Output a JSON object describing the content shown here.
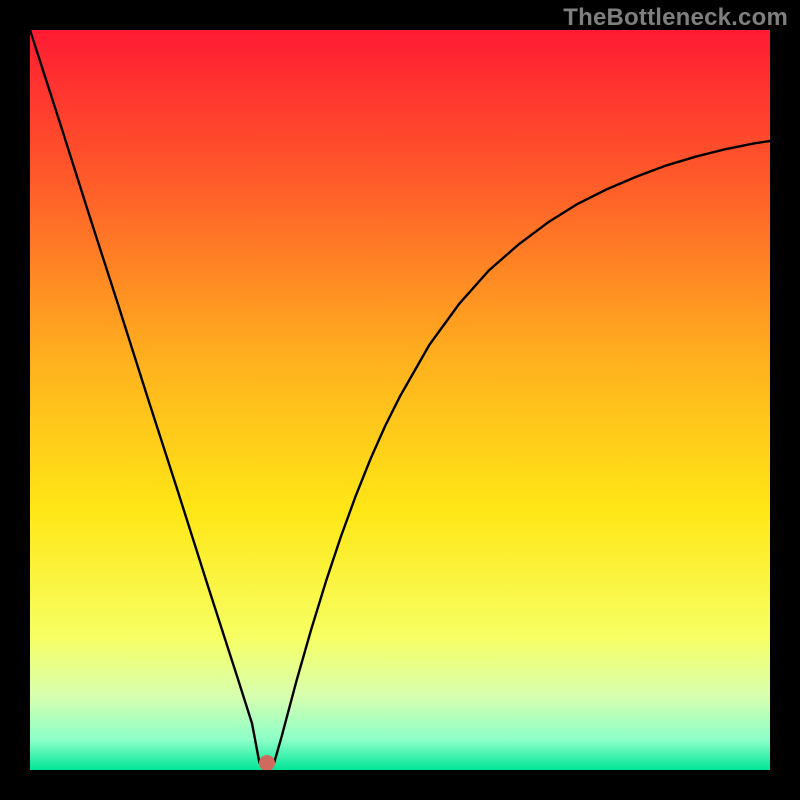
{
  "watermark": "TheBottleneck.com",
  "colors": {
    "frame": "#000000",
    "watermark": "#7f7f7f",
    "curve": "#000000",
    "minpoint": "#cf6a5c",
    "gradient_stops": [
      {
        "pos": 0.0,
        "color": "#ff1b33"
      },
      {
        "pos": 0.2,
        "color": "#ff5a2a"
      },
      {
        "pos": 0.45,
        "color": "#ffb21e"
      },
      {
        "pos": 0.65,
        "color": "#ffe716"
      },
      {
        "pos": 0.82,
        "color": "#f7ff63"
      },
      {
        "pos": 0.9,
        "color": "#d8ffb0"
      },
      {
        "pos": 0.96,
        "color": "#8affc8"
      },
      {
        "pos": 1.0,
        "color": "#00e597"
      }
    ]
  },
  "chart_data": {
    "type": "line",
    "title": "",
    "xlabel": "",
    "ylabel": "",
    "xlim": [
      0,
      100
    ],
    "ylim": [
      0,
      100
    ],
    "x": [
      0,
      2,
      4,
      6,
      8,
      10,
      12,
      14,
      16,
      18,
      20,
      22,
      24,
      26,
      28,
      30,
      31,
      32,
      33,
      34,
      36,
      38,
      40,
      42,
      44,
      46,
      48,
      50,
      54,
      58,
      62,
      66,
      70,
      74,
      78,
      82,
      86,
      90,
      94,
      98,
      100
    ],
    "values": [
      100,
      93.8,
      87.6,
      81.3,
      75,
      68.8,
      62.6,
      56.3,
      50,
      43.8,
      37.6,
      31.3,
      25,
      18.8,
      12.6,
      6.3,
      1.0,
      1.0,
      1.0,
      4.5,
      12.0,
      19.0,
      25.5,
      31.5,
      37.0,
      42.0,
      46.5,
      50.5,
      57.5,
      63.0,
      67.5,
      71.0,
      74.0,
      76.5,
      78.5,
      80.2,
      81.7,
      82.9,
      83.9,
      84.7,
      85.0
    ],
    "min_point": {
      "x": 32,
      "y": 1.0
    }
  }
}
